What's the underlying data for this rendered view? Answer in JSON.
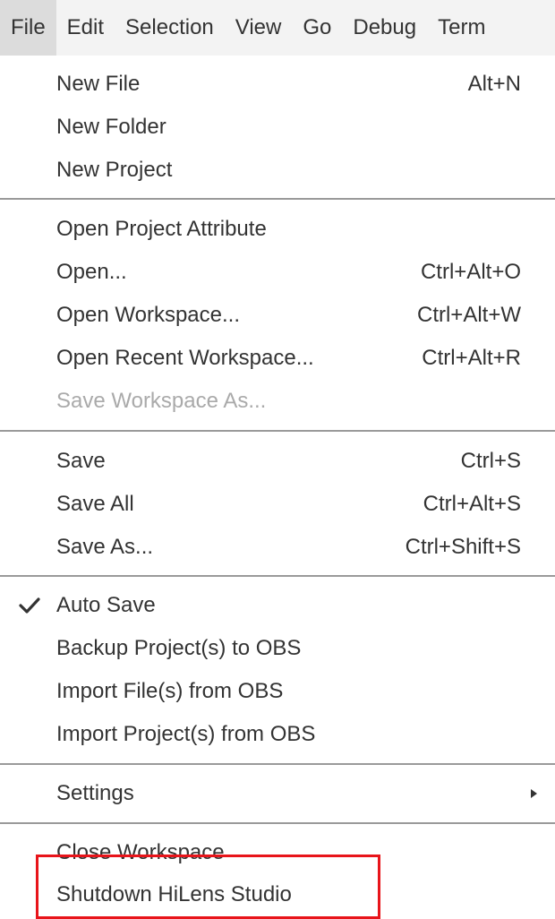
{
  "menubar": {
    "items": [
      {
        "label": "File",
        "active": true
      },
      {
        "label": "Edit"
      },
      {
        "label": "Selection"
      },
      {
        "label": "View"
      },
      {
        "label": "Go"
      },
      {
        "label": "Debug"
      },
      {
        "label": "Term"
      }
    ]
  },
  "file_menu": {
    "items": [
      {
        "label": "New File",
        "shortcut": "Alt+N"
      },
      {
        "label": "New Folder",
        "shortcut": ""
      },
      {
        "label": "New Project",
        "shortcut": ""
      },
      {
        "label": "Open Project Attribute",
        "shortcut": ""
      },
      {
        "label": "Open...",
        "shortcut": "Ctrl+Alt+O"
      },
      {
        "label": "Open Workspace...",
        "shortcut": "Ctrl+Alt+W"
      },
      {
        "label": "Open Recent Workspace...",
        "shortcut": "Ctrl+Alt+R"
      },
      {
        "label": "Save Workspace As...",
        "shortcut": "",
        "disabled": true
      },
      {
        "label": "Save",
        "shortcut": "Ctrl+S"
      },
      {
        "label": "Save All",
        "shortcut": "Ctrl+Alt+S"
      },
      {
        "label": "Save As...",
        "shortcut": "Ctrl+Shift+S"
      },
      {
        "label": "Auto Save",
        "shortcut": "",
        "checked": true
      },
      {
        "label": "Backup Project(s) to OBS",
        "shortcut": ""
      },
      {
        "label": "Import File(s) from OBS",
        "shortcut": ""
      },
      {
        "label": "Import Project(s) from OBS",
        "shortcut": ""
      },
      {
        "label": "Settings",
        "shortcut": "",
        "submenu": true
      },
      {
        "label": "Close Workspace",
        "shortcut": ""
      },
      {
        "label": "Shutdown HiLens Studio",
        "shortcut": "",
        "highlighted": true
      }
    ]
  },
  "colors": {
    "highlight_border": "#e8141a",
    "disabled_text": "#aaaaaa",
    "menubar_bg": "#f3f3f3",
    "active_menubar_bg": "#dcdcdc"
  },
  "icons": {
    "checkmark": "checkmark-icon",
    "submenu": "chevron-right-icon"
  }
}
